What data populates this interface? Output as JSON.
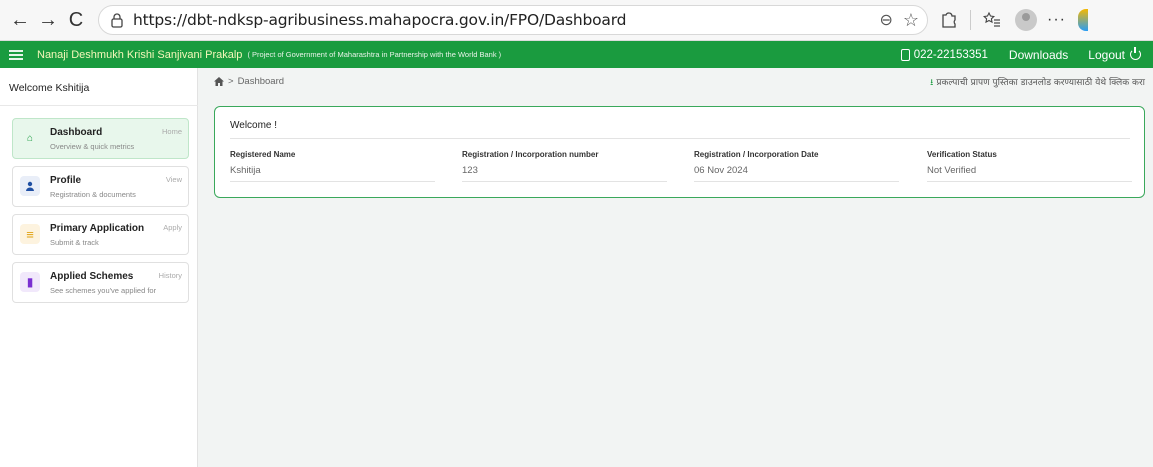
{
  "browser": {
    "url": "https://dbt-ndksp-agribusiness.mahapocra.gov.in/FPO/Dashboard",
    "back_glyph": "←",
    "forward_glyph": "→",
    "reload_glyph": "C",
    "zoom_glyph": "⊖",
    "star_glyph": "☆",
    "more_glyph": "···"
  },
  "header": {
    "brand": "Nanaji Deshmukh Krishi Sanjivani Prakalp",
    "brand_sub": "( Project of Government of Maharashtra in Partnership with the World Bank )",
    "phone": "022-22153351",
    "downloads": "Downloads",
    "logout": "Logout",
    "bg_color": "#1a9b3f"
  },
  "sidebar": {
    "welcome": "Welcome Kshitija",
    "items": [
      {
        "title": "Dashboard",
        "subtitle": "Overview & quick metrics",
        "action": "Home",
        "icon": "home-icon",
        "icon_glyph": "⌂",
        "color": "#1a9b3f"
      },
      {
        "title": "Profile",
        "subtitle": "Registration & documents",
        "action": "View",
        "icon": "user-icon",
        "icon_glyph": "●",
        "color": "#1f4fa3"
      },
      {
        "title": "Primary Application",
        "subtitle": "Submit & track",
        "action": "Apply",
        "icon": "list-icon",
        "icon_glyph": "≡",
        "color": "#e0a010"
      },
      {
        "title": "Applied Schemes",
        "subtitle": "See schemes you've applied for",
        "action": "History",
        "icon": "scheme-icon",
        "icon_glyph": "▮",
        "color": "#7a2fd1"
      }
    ]
  },
  "breadcrumb": {
    "current": "Dashboard",
    "separator": ">"
  },
  "download_note": "प्रकल्पाची प्रापण पुस्तिका डाउनलोड करण्यासाठी येथे क्लिक करा",
  "card": {
    "title": "Welcome !",
    "fields": [
      {
        "label": "Registered Name",
        "value": "Kshitija"
      },
      {
        "label": "Registration / Incorporation number",
        "value": "123"
      },
      {
        "label": "Registration / Incorporation Date",
        "value": "06 Nov 2024"
      },
      {
        "label": "Verification Status",
        "value": "Not Verified"
      }
    ]
  }
}
